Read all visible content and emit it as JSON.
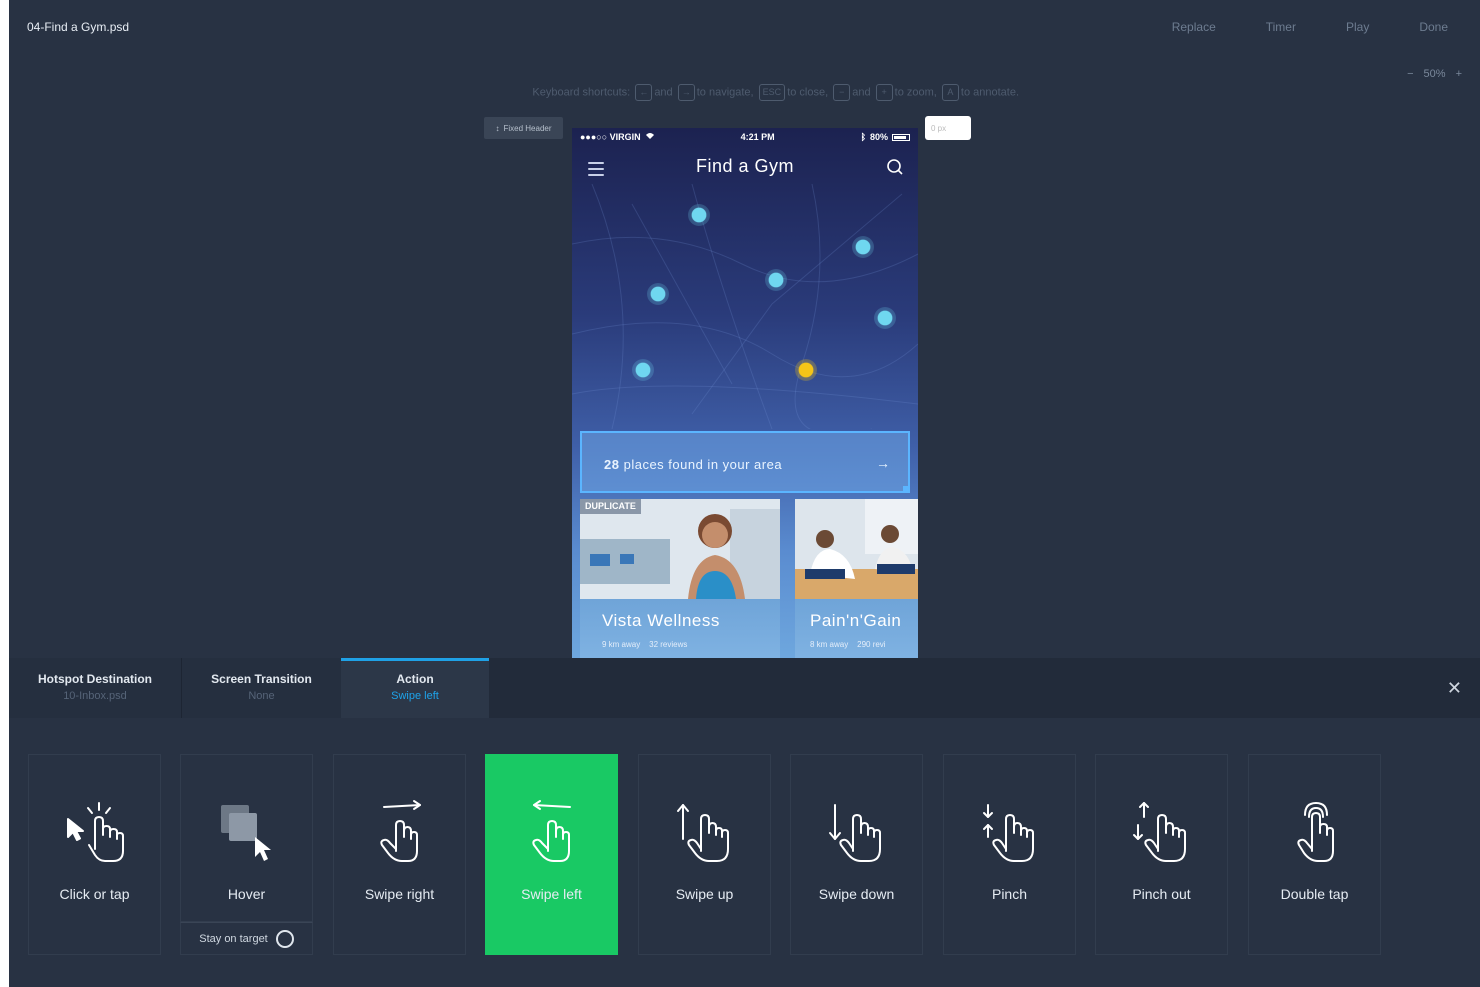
{
  "header": {
    "file_title": "04-Find a Gym.psd",
    "actions": [
      "Replace",
      "Timer",
      "Play",
      "Done"
    ],
    "zoom": {
      "minus": "−",
      "value": "50%",
      "plus": "+"
    }
  },
  "shortcuts": {
    "prefix": "Keyboard shortcuts:",
    "k1": "←",
    "and1": "and",
    "k2": "→",
    "t1": "to navigate,",
    "k3": "ESC",
    "t2": "to close,",
    "k4": "−",
    "and2": "and",
    "k5": "+",
    "t3": "to zoom,",
    "k6": "A",
    "t4": "to annotate."
  },
  "fixed_header": {
    "label": "Fixed Header"
  },
  "offset_input": {
    "placeholder": "0 px"
  },
  "phone": {
    "status": {
      "carrier": "●●●○○ VIRGIN",
      "time": "4:21 PM",
      "battery": "80%"
    },
    "title": "Find a Gym",
    "banner": {
      "count": "28",
      "text": "places found in your area",
      "arrow": "→"
    },
    "badge": "DUPLICATE",
    "cards": [
      {
        "name": "Vista Wellness",
        "distance": "9 km away",
        "reviews": "32 reviews"
      },
      {
        "name": "Pain'n'Gain",
        "distance": "8 km away",
        "reviews": "290 revi"
      }
    ]
  },
  "tabs": [
    {
      "label": "Hotspot Destination",
      "sub": "10-Inbox.psd"
    },
    {
      "label": "Screen Transition",
      "sub": "None"
    },
    {
      "label": "Action",
      "sub": "Swipe left"
    }
  ],
  "close": "✕",
  "gestures": [
    {
      "label": "Click or tap",
      "icon": "tap-icon"
    },
    {
      "label": "Hover",
      "icon": "hover-icon"
    },
    {
      "label": "Swipe right",
      "icon": "swipe-right-icon"
    },
    {
      "label": "Swipe left",
      "icon": "swipe-left-icon"
    },
    {
      "label": "Swipe up",
      "icon": "swipe-up-icon"
    },
    {
      "label": "Swipe down",
      "icon": "swipe-down-icon"
    },
    {
      "label": "Pinch",
      "icon": "pinch-icon"
    },
    {
      "label": "Pinch out",
      "icon": "pinch-out-icon"
    },
    {
      "label": "Double tap",
      "icon": "double-tap-icon"
    }
  ],
  "stay_on_target": "Stay on target",
  "colors": {
    "background": "#283243",
    "accent": "#1fa1e6",
    "active": "#19c964",
    "pin": "#6fd7f0",
    "pin_selected": "#f5c518"
  }
}
